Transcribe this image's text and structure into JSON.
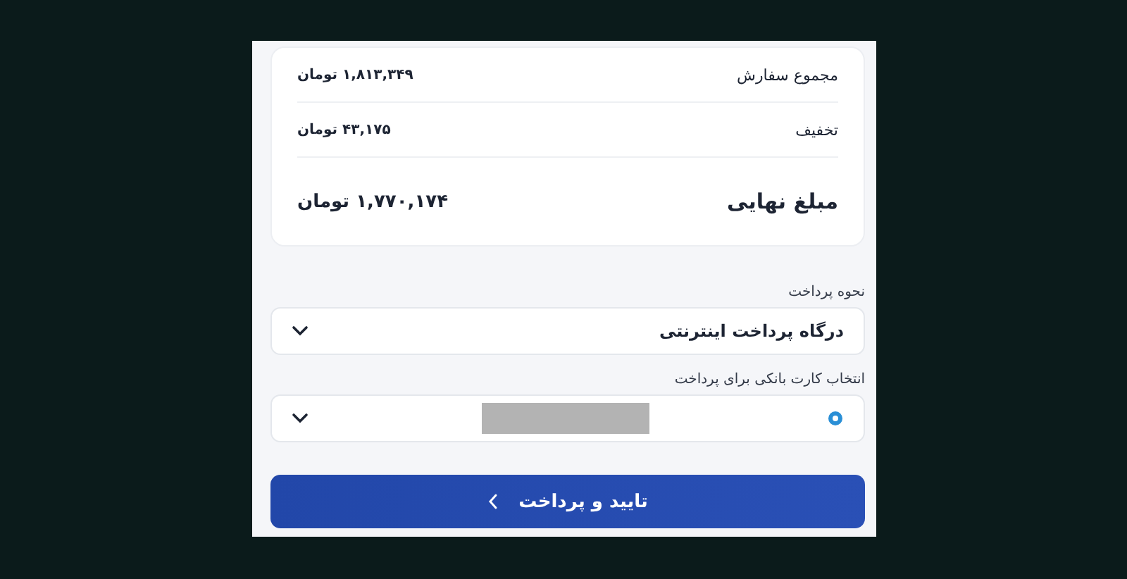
{
  "summary": {
    "rows": [
      {
        "kind": "line",
        "label": "مجموع سفارش",
        "value": "۱,۸۱۳,۳۴۹ تومان"
      },
      {
        "kind": "line",
        "label": "تخفیف",
        "value": "۴۳,۱۷۵ تومان"
      },
      {
        "kind": "total",
        "label": "مبلغ نهایی",
        "value": "۱,۷۷۰,۱۷۴ تومان"
      }
    ]
  },
  "payment_method": {
    "label": "نحوه پرداخت",
    "value": "درگاه پرداخت اینترنتی"
  },
  "bank_card": {
    "label": "انتخاب کارت بانکی برای پرداخت",
    "redacted": true
  },
  "submit_button": {
    "label": "تایید و پرداخت"
  }
}
